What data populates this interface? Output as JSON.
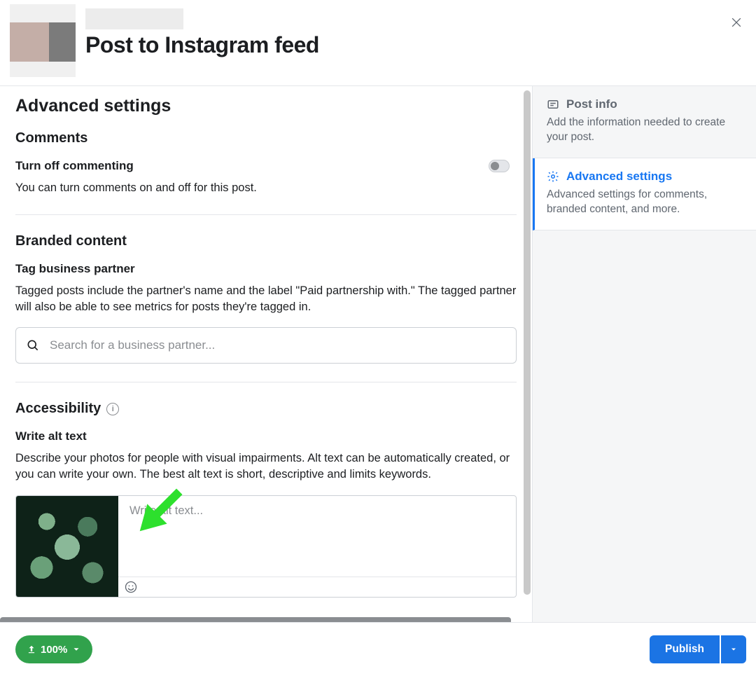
{
  "header": {
    "title": "Post to Instagram feed"
  },
  "main": {
    "section_title": "Advanced settings",
    "comments": {
      "heading": "Comments",
      "toggle_label": "Turn off commenting",
      "description": "You can turn comments on and off for this post.",
      "toggle_on": false
    },
    "branded": {
      "heading": "Branded content",
      "setting_label": "Tag business partner",
      "description": "Tagged posts include the partner's name and the label \"Paid partnership with.\" The tagged partner will also be able to see metrics for posts they're tagged in.",
      "search_placeholder": "Search for a business partner..."
    },
    "accessibility": {
      "heading": "Accessibility",
      "setting_label": "Write alt text",
      "description": "Describe your photos for people with visual impairments. Alt text can be automatically created, or you can write your own. The best alt text is short, descriptive and limits keywords.",
      "alt_placeholder": "Write alt text..."
    }
  },
  "sidebar": {
    "items": [
      {
        "title": "Post info",
        "description": "Add the information needed to create your post.",
        "active": false
      },
      {
        "title": "Advanced settings",
        "description": "Advanced settings for comments, branded content, and more.",
        "active": true
      }
    ]
  },
  "footer": {
    "upload_percent": "100%",
    "publish_label": "Publish"
  },
  "colors": {
    "primary_blue": "#1b74e4",
    "accent_green": "#31a24c",
    "arrow_green": "#31e82c"
  }
}
